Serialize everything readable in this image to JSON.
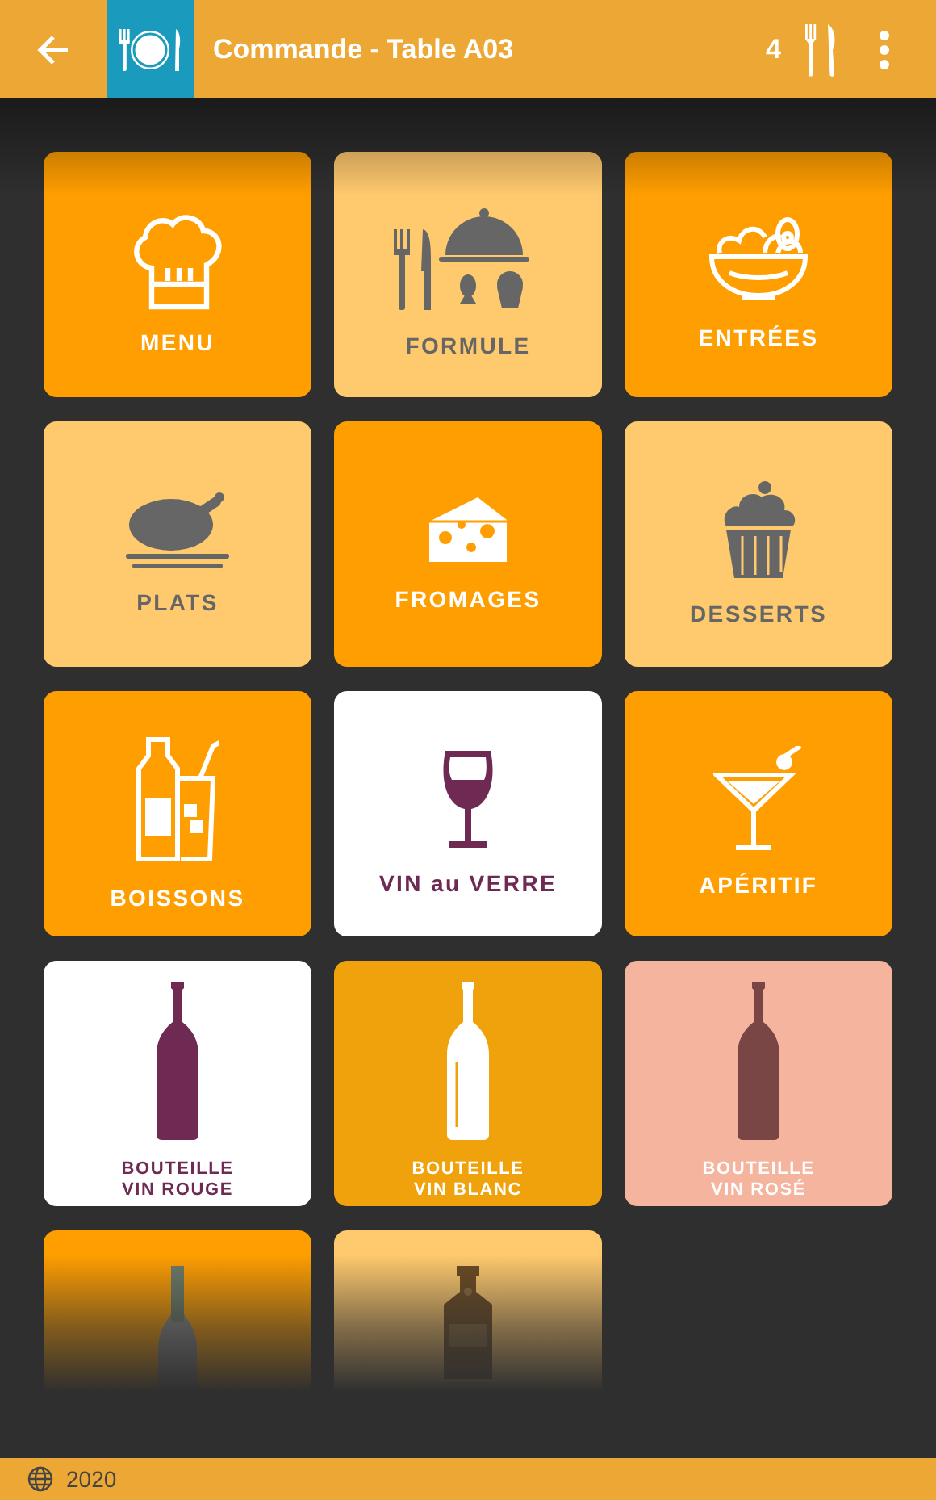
{
  "header": {
    "title": "Commande - Table A03",
    "covers": "4"
  },
  "tiles": [
    {
      "label": "MENU",
      "kind": "orange"
    },
    {
      "label": "FORMULE",
      "kind": "light"
    },
    {
      "label": "ENTRÉES",
      "kind": "orange"
    },
    {
      "label": "PLATS",
      "kind": "light"
    },
    {
      "label": "FROMAGES",
      "kind": "orange"
    },
    {
      "label": "DESSERTS",
      "kind": "light"
    },
    {
      "label": "BOISSONS",
      "kind": "orange"
    },
    {
      "label": "VIN au VERRE",
      "kind": "white"
    },
    {
      "label": "APÉRITIF",
      "kind": "orange"
    },
    {
      "label": "BOUTEILLE VIN ROUGE",
      "kind": "white"
    },
    {
      "label": "BOUTEILLE VIN BLANC",
      "kind": "gold"
    },
    {
      "label": "BOUTEILLE VIN ROSÉ",
      "kind": "pink"
    },
    {
      "kind": "orange"
    },
    {
      "kind": "light"
    }
  ],
  "footer": {
    "year": "2020"
  }
}
